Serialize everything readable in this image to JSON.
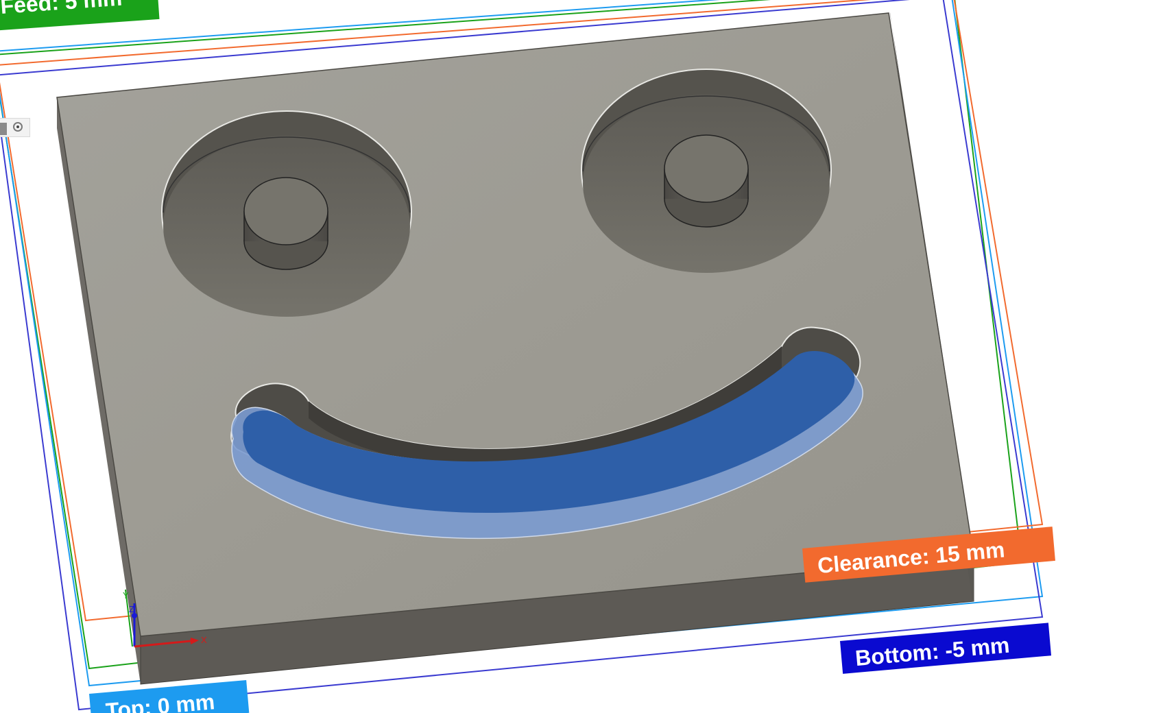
{
  "labels": {
    "feed": "Feed: 5 mm",
    "clearance": "Clearance: 15 mm",
    "bottom": "Bottom: -5 mm",
    "top": "Top: 0 mm"
  },
  "triad": {
    "x": "X",
    "y": "Y",
    "z": "Z"
  },
  "colors": {
    "feed": "#1aa21a",
    "clearance": "#f26a2e",
    "bottom": "#0a0ad0",
    "top": "#1d9bf0",
    "stock_top": "#9b9991",
    "stock_side": "#5d5a55",
    "pocket": "#66645d",
    "toolpath_selected": "#2e5fa8"
  },
  "icons": {
    "view_widget": "viewcube-eye-icon",
    "triad": "axis-triad-icon"
  }
}
